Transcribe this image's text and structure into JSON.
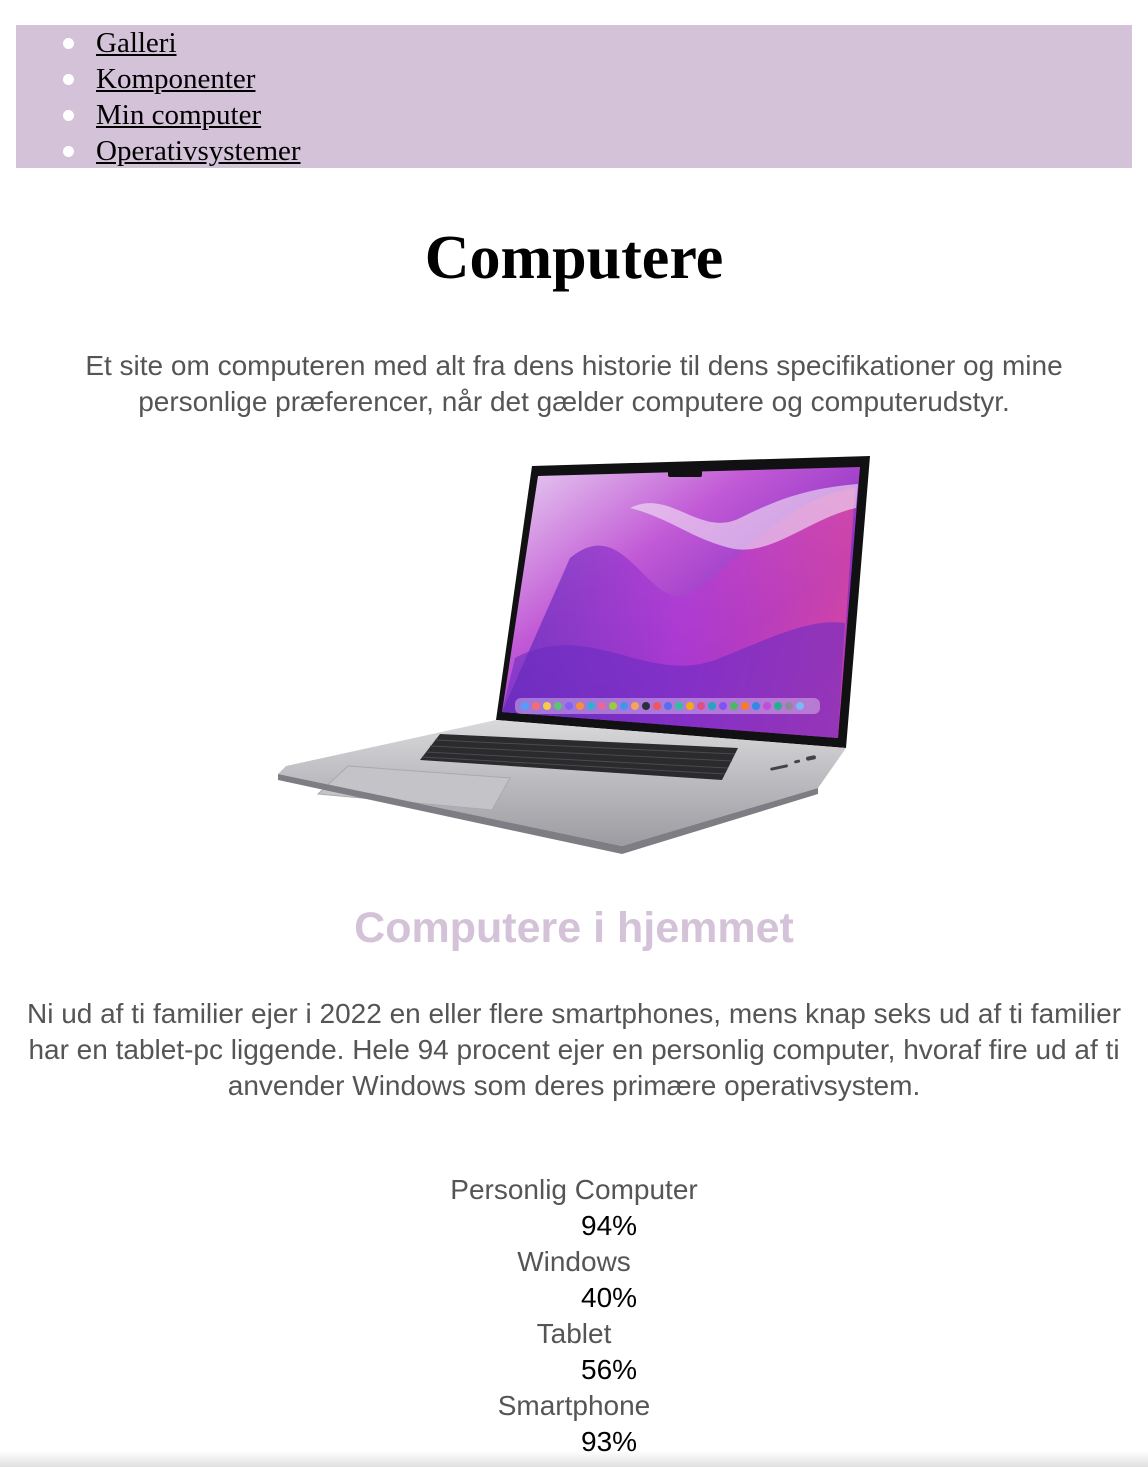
{
  "nav": {
    "items": [
      {
        "label": "Galleri"
      },
      {
        "label": "Komponenter"
      },
      {
        "label": "Min computer"
      },
      {
        "label": "Operativsystemer"
      }
    ]
  },
  "header": {
    "title": "Computere",
    "intro": "Et site om computeren med alt fra dens historie til dens specifikationer og mine personlige præferencer, når det gælder computere og computerudstyr."
  },
  "section": {
    "title": "Computere i hjemmet",
    "text": "Ni ud af ti familier ejer i 2022 en eller flere smartphones, mens knap seks ud af ti familier har en tablet-pc liggende. Hele 94 procent ejer en personlig computer, hvoraf fire ud af ti anvender Windows som deres primære operativsystem."
  },
  "stats": [
    {
      "label": "Personlig Computer",
      "value": "94%"
    },
    {
      "label": "Windows",
      "value": "40%"
    },
    {
      "label": "Tablet",
      "value": "56%"
    },
    {
      "label": "Smartphone",
      "value": "93%"
    }
  ],
  "colors": {
    "nav_background": "#d4c2d8",
    "section_title": "#d4c2d8",
    "body_text": "#555555"
  },
  "image": {
    "icon": "laptop-image"
  }
}
